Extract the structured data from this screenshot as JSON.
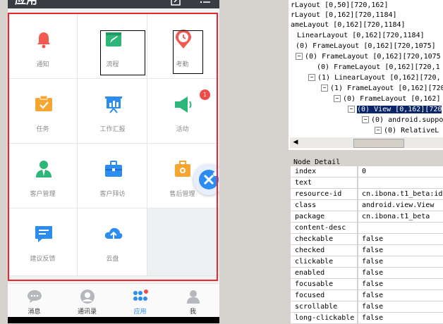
{
  "app": {
    "title": "应用"
  },
  "grid": {
    "items": [
      {
        "label": "通知",
        "icon": "bell-icon",
        "color": "#f25a4f"
      },
      {
        "label": "流程",
        "icon": "flow-icon",
        "color": "#2cb677"
      },
      {
        "label": "考勤",
        "icon": "clock-icon",
        "color": "#f25a4f"
      },
      {
        "label": "任务",
        "icon": "task-icon",
        "color": "#f7a531"
      },
      {
        "label": "工作汇报",
        "icon": "report-icon",
        "color": "#2d8cf0"
      },
      {
        "label": "活动",
        "icon": "speaker-icon",
        "color": "#2cb677",
        "badge": "1"
      },
      {
        "label": "客户管理",
        "icon": "customer-icon",
        "color": "#2cb677"
      },
      {
        "label": "客户拜访",
        "icon": "briefcase-icon",
        "color": "#2d8cf0"
      },
      {
        "label": "售后管理",
        "icon": "toolbox-icon",
        "color": "#f7a531"
      },
      {
        "label": "建议反馈",
        "icon": "feedback-icon",
        "color": "#2d8cf0"
      },
      {
        "label": "云盘",
        "icon": "cloud-icon",
        "color": "#2d8cf0"
      }
    ]
  },
  "nav": {
    "items": [
      {
        "label": "消息",
        "icon": "chat-icon"
      },
      {
        "label": "通讯录",
        "icon": "contacts-icon"
      },
      {
        "label": "应用",
        "icon": "apps-icon",
        "active": true
      },
      {
        "label": "我",
        "icon": "user-icon"
      }
    ]
  },
  "tree": {
    "lines": [
      "rLayout [0,50][720,162]",
      "rLayout [0,162][720,1184]",
      "ameLayout [0,162][720,1184]",
      "LinearLayout [0,162][720,1184]",
      "(0) FrameLayout [0,162][720,1075]",
      "(0) FrameLayout [0,162][720,1075",
      "(0) FrameLayout [0,162][720,1",
      "(1) LinearLayout [0,162][720,",
      "(1) FrameLayout [0,162][720",
      "(0) FrameLayout [0,162]",
      "(0) View [0,162][720",
      "(0) android.suppo",
      "(0) RelativeL"
    ]
  },
  "detail": {
    "title": "Node Detail",
    "rows": [
      {
        "key": "index",
        "value": "0"
      },
      {
        "key": "text",
        "value": ""
      },
      {
        "key": "resource-id",
        "value": "cn.ibona.t1_beta:id"
      },
      {
        "key": "class",
        "value": "android.view.View"
      },
      {
        "key": "package",
        "value": "cn.ibona.t1_beta"
      },
      {
        "key": "content-desc",
        "value": ""
      },
      {
        "key": "checkable",
        "value": "false"
      },
      {
        "key": "checked",
        "value": "false"
      },
      {
        "key": "clickable",
        "value": "false"
      },
      {
        "key": "enabled",
        "value": "false"
      },
      {
        "key": "focusable",
        "value": "false"
      },
      {
        "key": "focused",
        "value": "false"
      },
      {
        "key": "scrollable",
        "value": "false"
      },
      {
        "key": "long-clickable",
        "value": "false"
      }
    ]
  }
}
